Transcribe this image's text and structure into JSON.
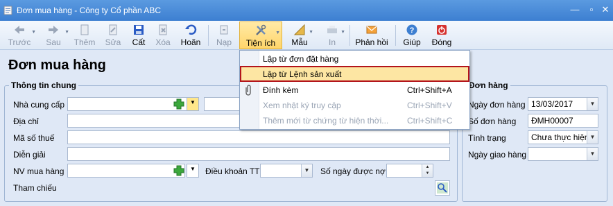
{
  "window": {
    "title": "Đơn mua hàng - Công ty Cổ phần ABC"
  },
  "toolbar": {
    "back": "Trước",
    "next": "Sau",
    "add": "Thêm",
    "edit": "Sửa",
    "save": "Cất",
    "delete": "Xóa",
    "undo": "Hoãn",
    "post": "Nạp",
    "utilities": "Tiện ích",
    "template": "Mẫu",
    "print": "In",
    "feedback": "Phản hồi",
    "help": "Giúp",
    "close": "Đóng"
  },
  "page": {
    "title": "Đơn mua hàng"
  },
  "general": {
    "legend": "Thông tin chung",
    "supplier_label": "Nhà cung cấp",
    "address_label": "Địa chỉ",
    "tax_label": "Mã số thuế",
    "desc_label": "Diễn giải",
    "staff_label": "NV mua hàng",
    "terms_label": "Điều khoản TT",
    "days_label": "Số ngày được nợ",
    "ref_label": "Tham chiếu"
  },
  "order": {
    "legend": "Đơn hàng",
    "date_label": "Ngày đơn hàng",
    "date_value": "13/03/2017",
    "number_label": "Số đơn hàng",
    "number_value": "ĐMH00007",
    "status_label": "Tình trạng",
    "status_value": "Chưa thực hiện",
    "delivery_label": "Ngày giao hàng",
    "delivery_value": ""
  },
  "menu": {
    "items": [
      {
        "label": "Lập từ đơn đặt hàng",
        "shortcut": ""
      },
      {
        "label": "Lập từ Lệnh sản xuất",
        "shortcut": ""
      },
      {
        "label": "Đính kèm",
        "shortcut": "Ctrl+Shift+A"
      },
      {
        "label": "Xem nhật ký truy cập",
        "shortcut": "Ctrl+Shift+V"
      },
      {
        "label": "Thêm mới từ chứng từ hiện thời...",
        "shortcut": "Ctrl+Shift+C"
      }
    ]
  },
  "colors": {
    "highlight_border": "#b3141b",
    "highlight_bg": "#fde6a3",
    "titlebar": "#3d7fd1"
  }
}
